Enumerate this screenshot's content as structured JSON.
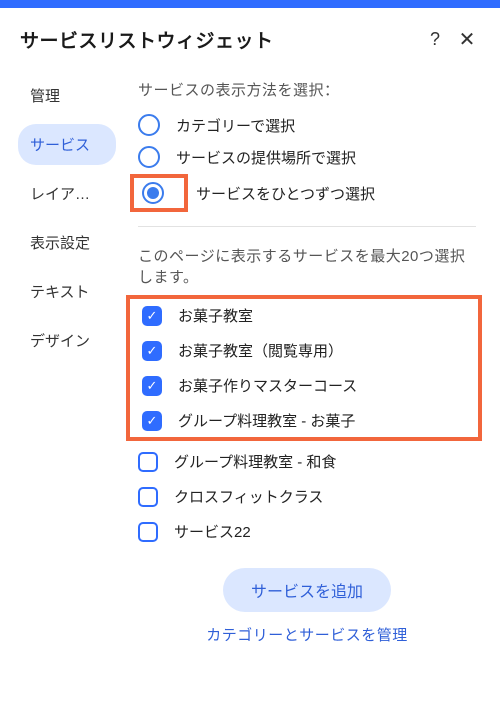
{
  "header": {
    "title": "サービスリストウィジェット",
    "help": "?",
    "close": "✕"
  },
  "sidebar": {
    "items": [
      {
        "label": "管理",
        "active": false
      },
      {
        "label": "サービス",
        "active": true
      },
      {
        "label": "レイア…",
        "active": false
      },
      {
        "label": "表示設定",
        "active": false
      },
      {
        "label": "テキスト",
        "active": false
      },
      {
        "label": "デザイン",
        "active": false
      }
    ]
  },
  "displayMethod": {
    "label": "サービスの表示方法を選択：",
    "options": [
      {
        "label": "カテゴリーで選択",
        "selected": false,
        "highlight": false
      },
      {
        "label": "サービスの提供場所で選択",
        "selected": false,
        "highlight": false
      },
      {
        "label": "サービスをひとつずつ選択",
        "selected": true,
        "highlight": true
      }
    ]
  },
  "serviceSelection": {
    "label": "このページに表示するサービスを最大20つ選択します。",
    "highlightedItems": [
      {
        "label": "お菓子教室",
        "checked": true
      },
      {
        "label": "お菓子教室（閲覧専用）",
        "checked": true
      },
      {
        "label": "お菓子作りマスターコース",
        "checked": true
      },
      {
        "label": "グループ料理教室 - お菓子",
        "checked": true
      }
    ],
    "items": [
      {
        "label": "グループ料理教室 - 和食",
        "checked": false
      },
      {
        "label": "クロスフィットクラス",
        "checked": false
      },
      {
        "label": "サービス22",
        "checked": false
      }
    ]
  },
  "footer": {
    "addButton": "サービスを追加",
    "manageLink": "カテゴリーとサービスを管理"
  },
  "colors": {
    "accent": "#2f6cff",
    "highlight": "#f2663c",
    "activeBg": "#dbe7ff"
  }
}
